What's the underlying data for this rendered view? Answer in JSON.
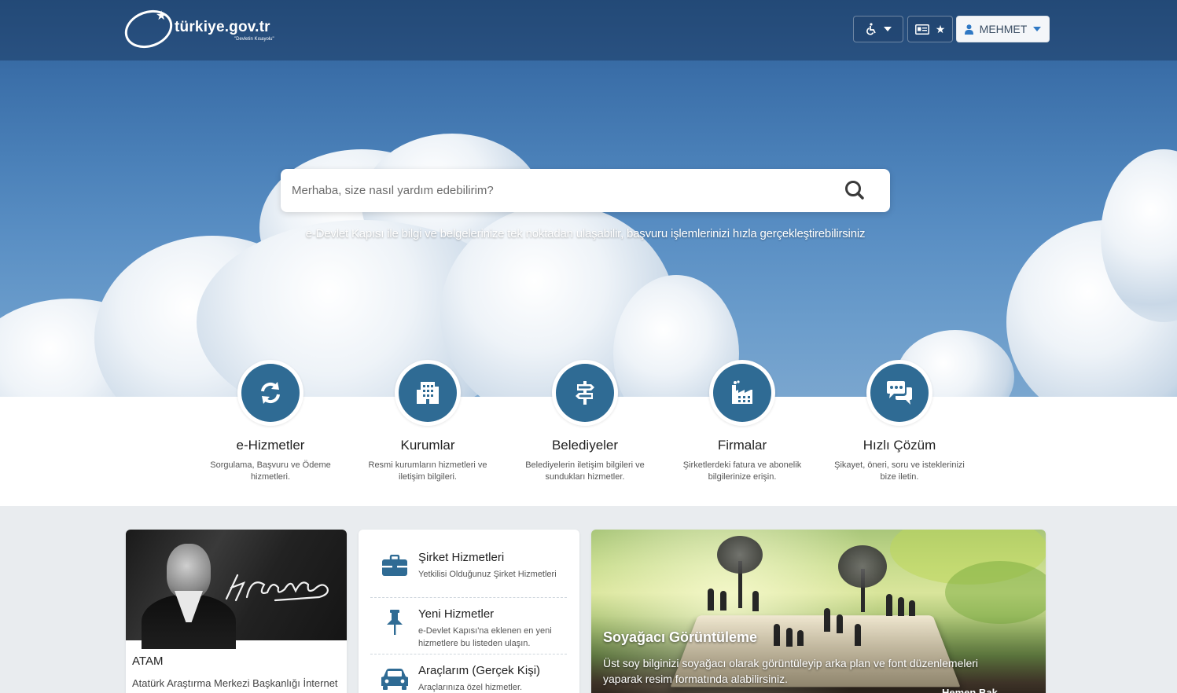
{
  "header": {
    "logo_text": "türkiye.gov.tr",
    "logo_sub": "\"Devletin Kısayolu\"",
    "user_name": "MEHMET",
    "icons": [
      "wheelchair-icon",
      "id-card-icon",
      "star-icon",
      "user-icon"
    ]
  },
  "search": {
    "placeholder": "Merhaba, size nasıl yardım edebilirim?",
    "icon": "search-icon"
  },
  "tagline": "e-Devlet Kapısı ile bilgi ve belgelerinize tek noktadan ulaşabilir, başvuru işlemlerinizi hızla gerçekleştirebilirsiniz",
  "categories": [
    {
      "title": "e-Hizmetler",
      "desc": "Sorgulama, Başvuru ve Ödeme hizmetleri.",
      "icon": "refresh-icon"
    },
    {
      "title": "Kurumlar",
      "desc": "Resmi kurumların hizmetleri ve iletişim bilgileri.",
      "icon": "building-icon"
    },
    {
      "title": "Belediyeler",
      "desc": "Belediyelerin iletişim bilgileri ve sundukları hizmetler.",
      "icon": "signpost-icon"
    },
    {
      "title": "Firmalar",
      "desc": "Şirketlerdeki fatura ve abonelik bilgilerinize erişin.",
      "icon": "factory-icon"
    },
    {
      "title": "Hızlı Çözüm",
      "desc": "Şikayet, öneri, soru ve isteklerinizi bize iletin.",
      "icon": "chat-icon"
    }
  ],
  "atam": {
    "title": "ATAM",
    "text": "Atatürk Araştırma Merkezi Başkanlığı İnternet"
  },
  "services": [
    {
      "title": "Şirket Hizmetleri",
      "desc": "Yetkilisi Olduğunuz Şirket Hizmetleri",
      "icon": "briefcase-icon"
    },
    {
      "title": "Yeni Hizmetler",
      "desc": "e-Devlet Kapısı'na eklenen en yeni hizmetlere bu listeden ulaşın.",
      "icon": "pin-icon"
    },
    {
      "title": "Araçlarım (Gerçek Kişi)",
      "desc": "Araçlarınıza özel hizmetler.",
      "icon": "car-icon"
    }
  ],
  "soyagaci": {
    "title": "Soyağacı Görüntüleme",
    "text": "Üst soy bilginizi soyağacı olarak görüntüleyip arka plan ve font düzenlemeleri yaparak resim formatında alabilirsiniz.",
    "more": "Hemen Bak"
  },
  "colors": {
    "icon_circle": "#2f6b94",
    "header_blue": "#2b5a8e"
  }
}
